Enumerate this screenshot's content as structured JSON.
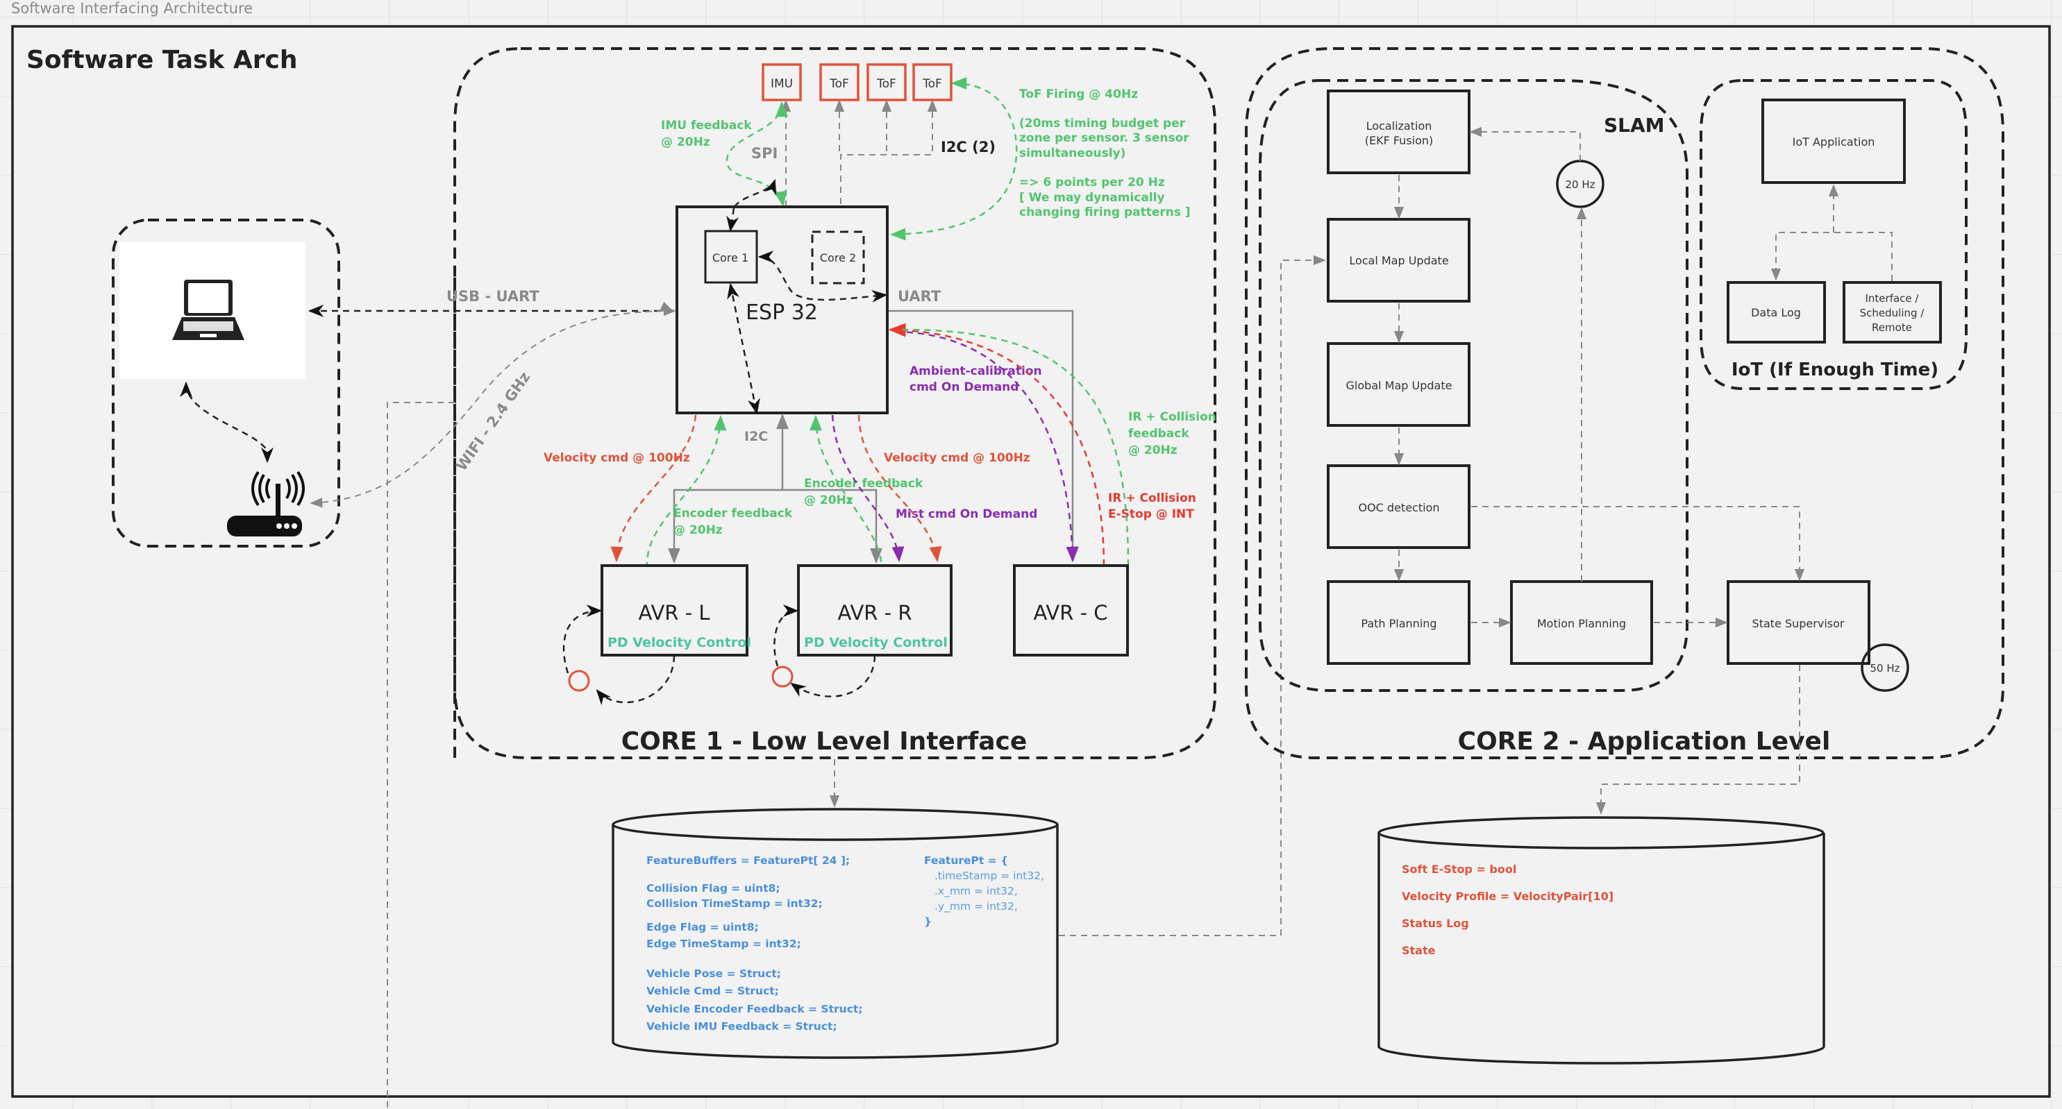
{
  "board": {
    "title": "Software Interfacing Architecture",
    "frame_title": "Software Task Arch"
  },
  "colors": {
    "sensor_border": "#e0533a",
    "feedback_green": "#52c46f",
    "command_orange": "#e0533a",
    "estop_red": "#e53a2e",
    "ondemand_purple": "#8a2cb0",
    "pd_teal": "#4dc4a3",
    "struct_blue": "#4a90d9"
  },
  "pc_group": {
    "laptop_icon": "laptop-icon",
    "router_icon": "wifi-router-icon"
  },
  "core1": {
    "title": "CORE 1 - Low Level Interface",
    "esp32": {
      "label": "ESP 32",
      "core1": "Core 1",
      "core2": "Core 2"
    },
    "sensors": [
      "IMU",
      "ToF",
      "ToF",
      "ToF"
    ],
    "avr": [
      {
        "label": "AVR - L",
        "sub": "PD Velocity Control"
      },
      {
        "label": "AVR - R",
        "sub": "PD Velocity Control"
      },
      {
        "label": "AVR - C",
        "sub": ""
      }
    ],
    "links": {
      "usb_uart": "USB - UART",
      "wifi": "WIFI - 2.4 GHz",
      "spi": "SPI",
      "i2c2": "I2C (2)",
      "uart": "UART",
      "i2c": "I2C"
    },
    "annotations": {
      "imu_feedback": [
        "IMU feedback",
        "@ 20Hz"
      ],
      "tof_note": [
        "ToF Firing @ 40Hz",
        "",
        "(20ms timing budget per",
        "zone per sensor. 3 sensor",
        "simultaneously)",
        "",
        "=> 6 points per 20 Hz",
        "[ We may dynamically",
        "changing firing patterns ]"
      ],
      "vel_cmd_left": "Velocity cmd @ 100Hz",
      "vel_cmd_right": "Velocity cmd @ 100Hz",
      "enc_fb_left": [
        "Encoder feedback",
        "@ 20Hz"
      ],
      "enc_fb_right": [
        "Encoder feedback",
        "@ 20Hz"
      ],
      "mist_cmd": "Mist cmd On Demand",
      "ambient_cmd": [
        "Ambient-calibration",
        "cmd On Demand"
      ],
      "ir_feedback": [
        "IR + Collision",
        "feedback",
        "@ 20Hz"
      ],
      "ir_estop": [
        "IR + Collision",
        "E-Stop @ INT"
      ]
    }
  },
  "core2": {
    "title": "CORE 2 - Application Level",
    "slam": {
      "title": "SLAM",
      "boxes": [
        "Localization",
        "(EKF Fusion)",
        "Local Map Update",
        "Global Map Update",
        "OOC detection",
        "Path Planning"
      ],
      "rate": "20 Hz"
    },
    "motion_planning": "Motion Planning",
    "state_supervisor": "State Supervisor",
    "supervisor_rate": "50 Hz",
    "iot": {
      "title": "IoT (If Enough Time)",
      "app": "IoT Application",
      "data_log": "Data Log",
      "interface": [
        "Interface /",
        "Scheduling /",
        "Remote"
      ]
    }
  },
  "shared_memory_core1": {
    "left": [
      "FeatureBuffers = FeaturePt[ 24 ];",
      "Collision Flag = uint8;",
      "Collision TimeStamp = int32;",
      "Edge Flag = uint8;",
      "Edge TimeStamp = int32;",
      "Vehicle Pose = Struct;",
      "Vehicle Cmd = Struct;",
      "Vehicle Encoder Feedback = Struct;",
      "Vehicle IMU Feedback = Struct;"
    ],
    "right_header": "FeaturePt = {",
    "right_fields": [
      ".timeStamp = int32,",
      ".x_mm = int32,",
      ".y_mm = int32,"
    ],
    "right_close": "}"
  },
  "shared_memory_core2": {
    "items": [
      "Soft E-Stop = bool",
      "Velocity Profile = VelocityPair[10]",
      "Status Log",
      "State"
    ]
  }
}
